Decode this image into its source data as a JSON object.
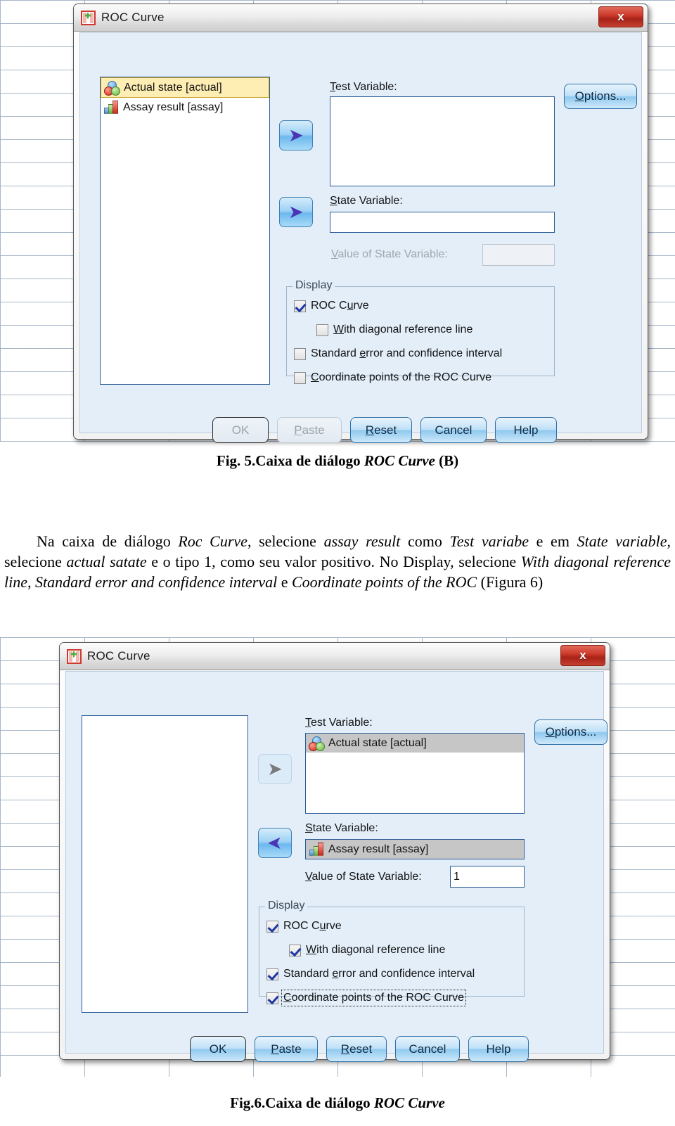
{
  "document": {
    "fig5_caption_prefix": "Fig. 5.Caixa de diálogo ",
    "fig5_caption_italic": "ROC Curve",
    "fig5_caption_suffix": " (B)",
    "fig6_caption_prefix": "Fig.6.Caixa de diálogo ",
    "fig6_caption_italic": "ROC Curve",
    "paragraph": {
      "t1": "Na caixa de diálogo ",
      "i1": "Roc Curve",
      "t2": ", selecione ",
      "i2": "assay result",
      "t3": " como ",
      "i3": "Test variabe",
      "t4": " e em ",
      "i4": "State variable,",
      "t5": " selecione ",
      "i5": "actual satate",
      "t6": " e o tipo 1, como seu valor positivo. No Display, selecione ",
      "i6": "With diagonal reference line, Standard error and confidence interval",
      "t7": " e ",
      "i7": "Coordinate points of the ROC",
      "t8": " (Figura 6)"
    }
  },
  "dialog_b": {
    "title": "ROC Curve",
    "window_icon": "spss-data-icon",
    "close_label": "x",
    "source_list": [
      {
        "label": "Actual state [actual]",
        "icon": "nominal-variable-icon",
        "selected": true
      },
      {
        "label": "Assay result [assay]",
        "icon": "scale-variable-icon",
        "selected": false
      }
    ],
    "test_variable": {
      "label": "Test Variable:",
      "accel": "T",
      "items": []
    },
    "state_variable": {
      "label": "State Variable:",
      "accel": "S",
      "value": ""
    },
    "value_of_state": {
      "label": "Value of State Variable:",
      "accel": "V",
      "value": "",
      "enabled": false
    },
    "options_button": {
      "label": "Options...",
      "accel": "O"
    },
    "move_to_test_arrow": {
      "icon": "arrow-right-icon",
      "enabled": true
    },
    "move_to_state_arrow": {
      "icon": "arrow-right-icon",
      "enabled": true
    },
    "display_group": {
      "title": "Display",
      "options": [
        {
          "label": "ROC Curve",
          "accel": "u",
          "checked": true,
          "indent": false,
          "focused": false
        },
        {
          "label": "With diagonal reference line",
          "accel": "W",
          "checked": false,
          "indent": true,
          "focused": false
        },
        {
          "label": "Standard error and confidence interval",
          "accel": "e",
          "checked": false,
          "indent": false,
          "focused": false
        },
        {
          "label": "Coordinate points of the ROC Curve",
          "accel": "C",
          "checked": false,
          "indent": false,
          "focused": false
        }
      ]
    },
    "buttons": [
      {
        "label": "OK",
        "enabled": false,
        "accel": ""
      },
      {
        "label": "Paste",
        "enabled": false,
        "accel": "P"
      },
      {
        "label": "Reset",
        "enabled": true,
        "accel": "R"
      },
      {
        "label": "Cancel",
        "enabled": true,
        "accel": ""
      },
      {
        "label": "Help",
        "enabled": true,
        "accel": ""
      }
    ]
  },
  "dialog_c": {
    "title": "ROC Curve",
    "window_icon": "spss-data-icon",
    "close_label": "x",
    "source_list": [],
    "test_variable": {
      "label": "Test Variable:",
      "accel": "T",
      "items": [
        {
          "label": "Actual state [actual]",
          "icon": "nominal-variable-icon",
          "selected": true
        }
      ]
    },
    "state_variable": {
      "label": "State Variable:",
      "accel": "S",
      "value": "Assay result [assay]",
      "icon": "scale-variable-icon"
    },
    "value_of_state": {
      "label": "Value of State Variable:",
      "accel": "V",
      "value": "1",
      "enabled": true
    },
    "options_button": {
      "label": "Options...",
      "accel": "O"
    },
    "move_to_test_arrow": {
      "icon": "arrow-right-icon",
      "enabled": false
    },
    "move_to_state_arrow": {
      "icon": "arrow-left-icon",
      "enabled": true
    },
    "display_group": {
      "title": "Display",
      "options": [
        {
          "label": "ROC Curve",
          "accel": "u",
          "checked": true,
          "indent": false,
          "focused": false
        },
        {
          "label": "With diagonal reference line",
          "accel": "W",
          "checked": true,
          "indent": true,
          "focused": false
        },
        {
          "label": "Standard error and confidence interval",
          "accel": "e",
          "checked": true,
          "indent": false,
          "focused": false
        },
        {
          "label": "Coordinate points of the ROC Curve",
          "accel": "C",
          "checked": true,
          "indent": false,
          "focused": true
        }
      ]
    },
    "buttons": [
      {
        "label": "OK",
        "enabled": true,
        "accel": ""
      },
      {
        "label": "Paste",
        "enabled": true,
        "accel": "P"
      },
      {
        "label": "Reset",
        "enabled": true,
        "accel": "R"
      },
      {
        "label": "Cancel",
        "enabled": true,
        "accel": ""
      },
      {
        "label": "Help",
        "enabled": true,
        "accel": ""
      }
    ]
  },
  "colors": {
    "dialog_body": "#e3eef9",
    "selection_yellow": "#ffeeb3",
    "selection_gray": "#c6c6c6",
    "close_red": "#cf3c2c",
    "accent_blue": "#2d6fa5"
  }
}
